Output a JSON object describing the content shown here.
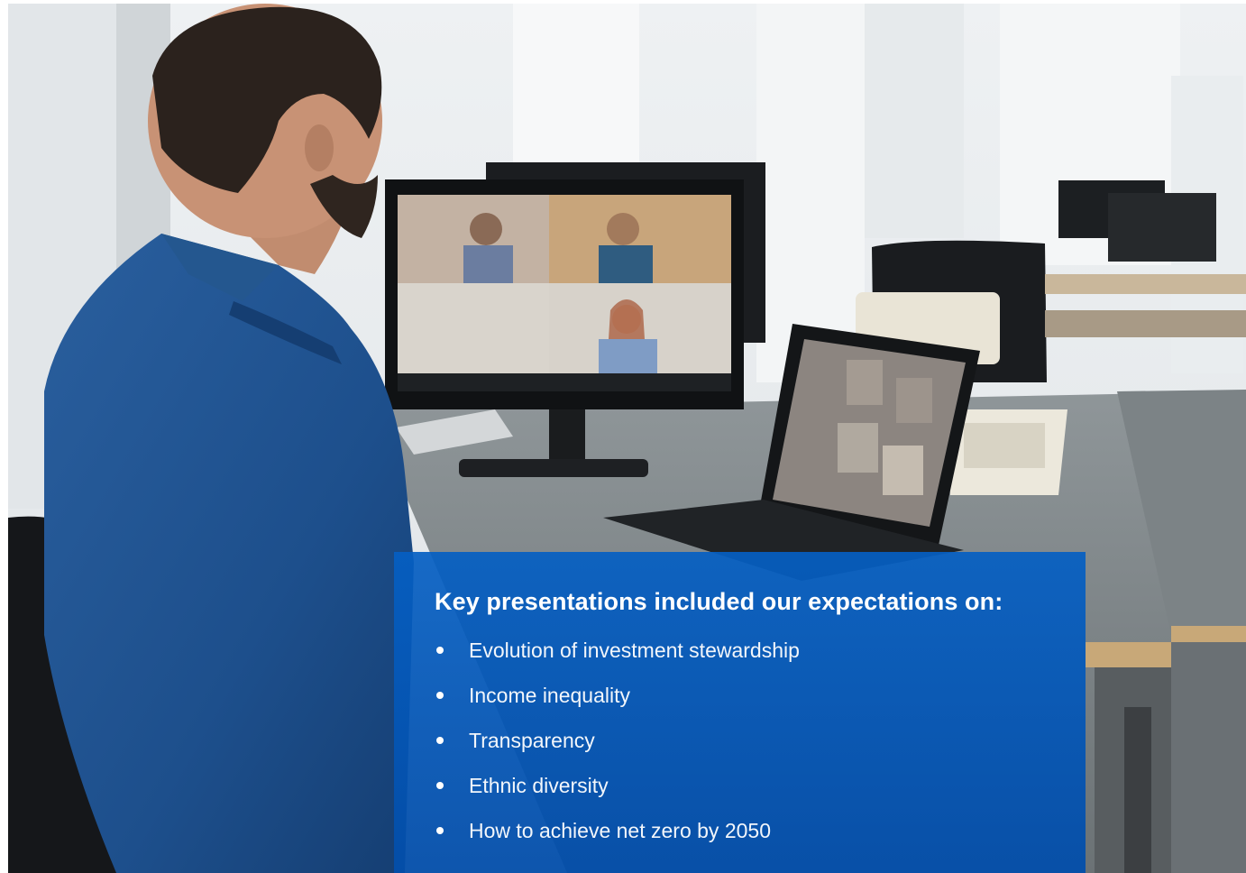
{
  "panel": {
    "title": "Key presentations included our expectations on:",
    "items": [
      "Evolution of investment stewardship",
      "Income inequality",
      "Transparency",
      "Ethnic diversity",
      "How to achieve net zero by 2050"
    ]
  },
  "colors": {
    "panel_blue": "#0456b0",
    "shirt_blue": "#1d4f8c",
    "background": "#ffffff"
  }
}
